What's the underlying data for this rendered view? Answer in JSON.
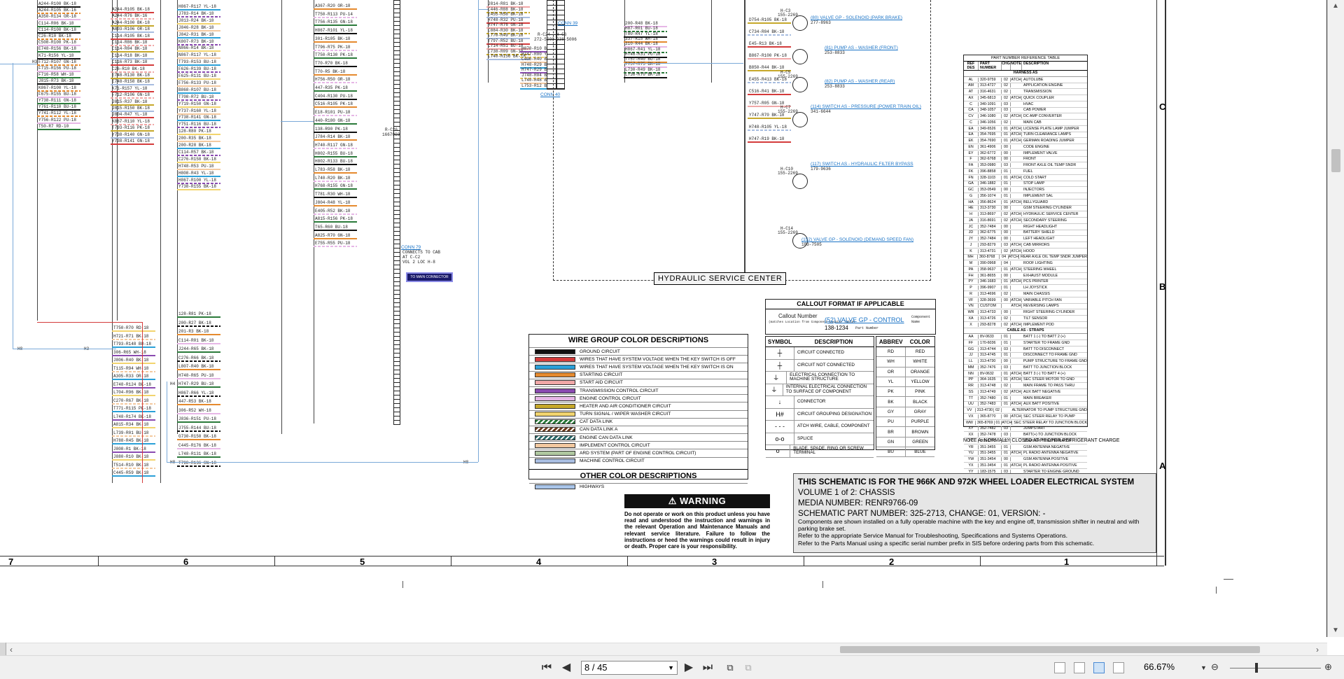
{
  "wire_group_color_descriptions": {
    "title": "WIRE GROUP COLOR DESCRIPTIONS",
    "rows": [
      {
        "color": "#111111",
        "label": "GROUND CIRCUIT"
      },
      {
        "color": "#d43b3b",
        "label": "WIRES THAT HAVE SYSTEM VOLTAGE WHEN THE KEY SWITCH IS OFF"
      },
      {
        "color": "#2aa0d8",
        "label": "WIRES THAT HAVE SYSTEM VOLTAGE WHEN THE KEY SWITCH IS ON"
      },
      {
        "color": "#e58a2e",
        "label": "STARTING CIRCUIT"
      },
      {
        "color": "#f1a8a8",
        "label": "START AID CIRCUIT"
      },
      {
        "color": "#8a4ab0",
        "label": "TRANSMISSION CONTROL CIRCUIT"
      },
      {
        "color": "#e6b7e6",
        "label": "ENGINE CONTROL CIRCUIT"
      },
      {
        "color": "#c6a82a",
        "label": "HEATER AND AIR CONDITIONER CIRCUIT"
      },
      {
        "color": "#f2d46e",
        "label": "TURN SIGNAL / WIPER WASHER CIRCUIT"
      },
      {
        "color": "#2a7a3a",
        "label": "CAT DATA LINK"
      },
      {
        "color": "#6b3a1a",
        "label": "CAN DATA LINK A"
      },
      {
        "color": "#2b6b6b",
        "label": "ENGINE CAN DATA LINK"
      },
      {
        "color": "#f3c9a0",
        "label": "IMPLEMENT CONTROL CIRCUIT"
      },
      {
        "color": "#b0c8a0",
        "label": "ARD SYSTEM (PART OF ENGINE CONTROL CIRCUIT)"
      },
      {
        "color": "#a8bde0",
        "label": "MACHINE CONTROL CIRCUIT"
      }
    ],
    "other_title": "OTHER COLOR DESCRIPTIONS",
    "other_rows": [
      {
        "color": "#a8c4e8",
        "label": "HIGHWAYS"
      }
    ]
  },
  "callout": {
    "title": "CALLOUT FORMAT IF APPLICABLE",
    "callout_number": "Callout Number",
    "callout_sub": "(matches Location from Component Locator Table)",
    "example": "(52) VALVE GP - CONTROL",
    "component_name": "Component Name",
    "part_number": "138-1234",
    "part_number_label": "Part Number"
  },
  "symbols": {
    "col_symbol": "SYMBOL",
    "col_description": "DESCRIPTION",
    "rows": [
      {
        "sym": "┼",
        "desc": "CIRCUIT CONNECTED"
      },
      {
        "sym": "┼",
        "desc": "CIRCUIT NOT CONNECTED"
      },
      {
        "sym": "⏚",
        "desc": "ELECTRICAL CONNECTION TO MACHINE STRUCTURE"
      },
      {
        "sym": "⏚",
        "desc": "INTERNAL ELECTRICAL CONNECTION TO SURFACE OF COMPONENT"
      },
      {
        "sym": "↓",
        "desc": "CONNECTOR"
      },
      {
        "sym": "H#",
        "desc": "CIRCUIT GROUPING DESIGNATION"
      },
      {
        "sym": "- - -",
        "desc": "ATCH WIRE, CABLE, COMPONENT"
      },
      {
        "sym": "o-o",
        "desc": "SPLICE"
      },
      {
        "sym": "o",
        "desc": "BLADE, SPADE, RING OR SCREW TERMINAL"
      }
    ]
  },
  "abbrev": {
    "col_abbrev": "ABBREV",
    "col_color": "COLOR",
    "rows": [
      {
        "a": "RD",
        "c": "RED"
      },
      {
        "a": "WH",
        "c": "WHITE"
      },
      {
        "a": "OR",
        "c": "ORANGE"
      },
      {
        "a": "YL",
        "c": "YELLOW"
      },
      {
        "a": "PK",
        "c": "PINK"
      },
      {
        "a": "BK",
        "c": "BLACK"
      },
      {
        "a": "GY",
        "c": "GRAY"
      },
      {
        "a": "PU",
        "c": "PURPLE"
      },
      {
        "a": "BR",
        "c": "BROWN"
      },
      {
        "a": "GN",
        "c": "GREEN"
      },
      {
        "a": "BU",
        "c": "BLUE"
      }
    ]
  },
  "part_number_reference": {
    "title": "PART NUMBER REFERENCE TABLE",
    "headers": [
      "REF DES",
      "PART NUMBER",
      "CHG",
      "NOTE",
      "DESCRIPTION"
    ],
    "section1": "HARNESS AS",
    "rows1": [
      [
        "AL",
        "320-9759",
        "02",
        "ATCH",
        "AUTOLUBE"
      ],
      [
        "AM",
        "313-4727",
        "02",
        "",
        "APPLICATION ENGINE"
      ],
      [
        "AT",
        "316-4631",
        "02",
        "",
        "TRANSMISSION"
      ],
      [
        "AX",
        "345-6813",
        "02",
        "ATCH",
        "QUICK COUPLER"
      ],
      [
        "C",
        "340-1091",
        "03",
        "",
        "HVAC"
      ],
      [
        "CA",
        "348-1057",
        "03",
        "",
        "CAB POWER"
      ],
      [
        "CV",
        "346-1080",
        "02",
        "ATCH",
        "DC AMP CONVERTER"
      ],
      [
        "C",
        "346-1056",
        "02",
        "",
        "MAIN CAB"
      ],
      [
        "EA",
        "349-6526",
        "01",
        "ATCH",
        "LICENSE PLATE LAMP JUMPER"
      ],
      [
        "EA",
        "354-7695",
        "01",
        "ATCH",
        "TURN CLEARANCE LAMPS"
      ],
      [
        "EK",
        "354-7690",
        "01",
        "ATCH",
        "GERMAN ROADING JUMPER"
      ],
      [
        "EN",
        "361-4906",
        "00",
        "",
        "CODE ENGINE"
      ],
      [
        "EY",
        "362-6772",
        "00",
        "",
        "IMPLEMENT VALVE"
      ],
      [
        "F",
        "362-6768",
        "00",
        "",
        "FRONT"
      ],
      [
        "FA",
        "353-0980",
        "03",
        "",
        "FRONT AXLE OIL TEMP SNDR"
      ],
      [
        "FK",
        "396-8858",
        "01",
        "",
        "FUEL"
      ],
      [
        "FN",
        "328-1103",
        "01",
        "ATCH",
        "COLD START"
      ],
      [
        "GA",
        "346-1882",
        "01",
        "",
        "STOP LAMP"
      ],
      [
        "GC",
        "353-0549",
        "00",
        "",
        "INJECTORS"
      ],
      [
        "G",
        "356-1074",
        "01",
        "",
        "IMPLEMENT SAL"
      ],
      [
        "HA",
        "356-8624",
        "01",
        "ATCH",
        "BELLYGUARD"
      ],
      [
        "HE",
        "313-3730",
        "00",
        "",
        "GSM STEERING CYLINDER"
      ],
      [
        "H",
        "313-8697",
        "02",
        "ATCH",
        "HYDRAULIC SERVICE CENTER"
      ],
      [
        "JA",
        "316-8691",
        "02",
        "ATCH",
        "SECONDARY STEERING"
      ],
      [
        "JC",
        "352-7484",
        "00",
        "",
        "RIGHT HEADLIGHT"
      ],
      [
        "JD",
        "362-6775",
        "00",
        "",
        "BATTERY SHIELD"
      ],
      [
        "JY",
        "352-7484",
        "00",
        "",
        "LEFT HEADLIGHT"
      ],
      [
        "J",
        "293-8279",
        "03",
        "ATCH",
        "CAB MIRRORS"
      ],
      [
        "K",
        "313-4731",
        "02",
        "ATCH",
        "HOOD"
      ],
      [
        "MH",
        "360-8768",
        "04",
        "ATCH",
        "REAR AXLE OIL TEMP SNDR JUMPER"
      ],
      [
        "M",
        "390-0968",
        "04",
        "",
        "ROOF LIGHTING"
      ],
      [
        "PA",
        "358-9637",
        "01",
        "ATCH",
        "STEERING WHEEL"
      ],
      [
        "FH",
        "361-8655",
        "00",
        "",
        "EXHAUST MODULE"
      ],
      [
        "PY",
        "346-1683",
        "01",
        "ATCH",
        "PCS PRINTER"
      ],
      [
        "P",
        "396-9907",
        "01",
        "",
        "LH JOYSTICK"
      ],
      [
        "R",
        "313-4696",
        "02",
        "",
        "MAIN CHASSIS"
      ],
      [
        "VF",
        "328-3699",
        "00",
        "ATCH",
        "VARIABLE PITCH FAN"
      ],
      [
        "VN",
        "CUSTOM",
        "",
        "ATCH",
        "REVERSING LAMPS"
      ],
      [
        "WR",
        "313-4733",
        "00",
        "",
        "RIGHT STEERING CYLINDER"
      ],
      [
        "XA",
        "313-4726",
        "02",
        "",
        "TILT SENSOR"
      ],
      [
        "X",
        "293-8278",
        "02",
        "ATCH",
        "IMPLEMENT POD"
      ]
    ],
    "section2": "CABLE AS - STRAPS",
    "rows2": [
      [
        "AA",
        "8V-0633",
        "01",
        "",
        "BATT 1 (-) TO BATT 2 (+)"
      ],
      [
        "FF",
        "170-6036",
        "01",
        "",
        "STARTER TO FRAME GND"
      ],
      [
        "GG",
        "313-4744",
        "03",
        "",
        "BATT TO DISCONNECT"
      ],
      [
        "JJ",
        "313-4745",
        "01",
        "",
        "DISCONNECT TO FRAME GND"
      ],
      [
        "LL",
        "313-4730",
        "00",
        "",
        "PUMP STRUCTURE TO FRAME GND"
      ],
      [
        "MM",
        "352-7476",
        "03",
        "",
        "BATT TO JUNCTION BLOCK"
      ],
      [
        "NN",
        "8V-0632",
        "01",
        "ATCH",
        "BATT 3 (-) TO BATT 4 (+)"
      ],
      [
        "PP",
        "364-1635",
        "01",
        "ATCH",
        "SEC STEER MOTOR TO GND"
      ],
      [
        "RR",
        "313-4748",
        "02",
        "",
        "MAIN FRAME TO PASS THRU"
      ],
      [
        "SS",
        "313-4749",
        "02",
        "ATCH",
        "AUX BATT NEGATIVE"
      ],
      [
        "TT",
        "352-7480",
        "01",
        "",
        "MAIN BREAKER"
      ],
      [
        "UU",
        "352-7483",
        "01",
        "ATCH",
        "AUX BATT POSITIVE"
      ],
      [
        "VV",
        "313-4730",
        "02",
        "",
        "ALTERNATOR TO PUMP STRUCTURE GND"
      ],
      [
        "VX",
        "365-8770",
        "00",
        "ATCH",
        "SEC STEER RELAY TO PUMP"
      ],
      [
        "WW",
        "365-8769",
        "01",
        "ATCH",
        "SEC STEER RELAY TO JUNCTION BLOCK"
      ],
      [
        "XY",
        "352-7482",
        "03",
        "",
        "JUMPSTART"
      ],
      [
        "XX",
        "352-7478",
        "03",
        "",
        "BATT(+) TO JUNCTION BLOCK"
      ],
      [
        "YC",
        "365-8771",
        "01",
        "",
        "STARTER TO ALTERNATOR"
      ],
      [
        "YR",
        "351-3455",
        "01",
        "",
        "GSM ANTENNA NEGATIVE"
      ],
      [
        "YU",
        "351-3455",
        "01",
        "ATCH",
        "PL RADIO ANTENNA NEGATIVE"
      ],
      [
        "YW",
        "351-3454",
        "00",
        "",
        "GSM ANTENNA POSITIVE"
      ],
      [
        "YX",
        "351-3454",
        "01",
        "ATCH",
        "PL RADIO ANTENNA POSITIVE"
      ],
      [
        "YY",
        "183-1575",
        "03",
        "",
        "STARTER TO ENGINE GROUND"
      ]
    ]
  },
  "note": "NOTE A: NORMALLY CLOSED AT PROPER REFRIGERANT CHARGE",
  "warning": {
    "header": "WARNING",
    "text": "Do not operate or work on this product unless you have read and understood the instruction and warnings in the relevant Operation and Maintenance Manuals and relevant service literature. Failure to follow the instructions or heed the warnings could result in injury or death. Proper care is your responsibility."
  },
  "title_block": {
    "line1": "THIS SCHEMATIC IS FOR THE 966K AND 972K WHEEL LOADER ELECTRICAL SYSTEM",
    "line2": "VOLUME 1 of 2: CHASSIS",
    "line3": "MEDIA NUMBER: RENR9766-09",
    "line4": "SCHEMATIC PART NUMBER: 325-2713, CHANGE: 01, VERSION: -",
    "line5": "Components are shown installed on a fully operable machine with the key and engine off, transmission shifter in neutral and with parking brake set.",
    "line6": "Refer to the appropriate Service Manual for Troubleshooting, Specifications and Systems Operations.",
    "line7": "Refer to the Parts Manual using a specific serial number prefix in SIS before ordering parts from this schematic."
  },
  "hydraulic_service_center": "HYDRAULIC SERVICE CENTER",
  "connectors": {
    "conn39": "CONN 39",
    "conn40": "CONN 40",
    "conn79": "CONN 79",
    "conn79_sub1": "CONNECTS TO CAB",
    "conn79_sub2": "AT C-C2",
    "conn79_sub3": "VOL 2 LOC H-8",
    "to_main": "TO MAIN CONNECTOR",
    "rc24": "R-C24",
    "rc24_pn": "272-5000",
    "hc6": "H-C6",
    "hc6_pn": "238-5006",
    "rc26": "R-C26",
    "rc26_pn": "1667000"
  },
  "components": [
    {
      "callout": "H-C3",
      "pn": "155-2269",
      "label": "(80) VALVE GP - SOLENOID (PARK BRAKE)",
      "pn2": "277-8963"
    },
    {
      "callout": "",
      "pn": "",
      "label": "(81) PUMP AS - WASHER (FRONT)",
      "pn2": "253-8833"
    },
    {
      "callout": "H-C5",
      "pn": "155-2269",
      "label": "(82) PUMP AS - WASHER (REAR)",
      "pn2": "253-8833"
    },
    {
      "callout": "H-C7",
      "pn": "155-2269",
      "label": "(114) SWITCH AS - PRESSURE (POWER TRAIN OIL)",
      "pn2": "341-6644"
    },
    {
      "callout": "H-C10",
      "pn": "155-2269",
      "label": "(117) SWITCH AS - HYDRAULIC FILTER BYPASS",
      "pn2": "179-9636"
    },
    {
      "callout": "H-C14",
      "pn": "155-2269",
      "label": "(152) VALVE GP - SOLENOID (DEMAND SPEED FAN)",
      "pn2": "183-7505"
    }
  ],
  "zones": [
    "C",
    "B",
    "A"
  ],
  "columns": [
    "7",
    "6",
    "5",
    "4",
    "3",
    "2",
    "1"
  ],
  "wire_bus_markers": [
    "H3",
    "H3",
    "H8",
    "H4",
    "H8",
    "H8"
  ],
  "wire_labels": {
    "bus1": [
      "A244-R100 BK-18",
      "A244-R105 BK-16",
      "A350-R134 OR-18",
      "C114-R06 BK-18",
      "C114-R100 BK-18",
      "C26-R10 BK-18",
      "C508-R100 PK-18",
      "E748-R156 BK-18",
      "K71-R156 YL-18",
      "F712-R107 GN-18",
      "F715-R156 PU-18",
      "F716-R58 WH-18",
      "J815-R73 BK-18",
      "K867-R100 YL-18",
      "F675-R155 BU-18",
      "Y738-R111 GN-18",
      "Y761-R110 BU-18",
      "Y741-R112 YL-18",
      "Y756-R122 PU-18",
      "T50-R7 RD-10"
    ],
    "bus2": [
      "A244-R105 BK-18",
      "A244-R76 BK-16",
      "A244-R100 BK-18",
      "A803-R106 OR-18",
      "C114-R105 BK-18",
      "C114-R86 BK-18",
      "C114-R04 BK-18",
      "C114-R18 BK-18",
      "C116-R73 BK-18",
      "C26-R10 BK-18",
      "E748-R130 BK-18",
      "E748-R158 BK-18",
      "K71-R157 YL-18",
      "F712-R106 GN-18",
      "J815-R37 BK-18",
      "J815-R150 BK-18",
      "J804-R47 YL-18",
      "K867-R110 YL-18",
      "T793-R116 PK-18",
      "Y738-R140 GN-18",
      "Y738-R141 GN-18"
    ],
    "bus3": [
      "H867-R117 YL-18",
      "J783-R14 BK-18",
      "J813-R24 BK-18",
      "J846-R28 BK-18",
      "J842-R31 BK-18",
      "K807-R73 BK-18",
      "N866-R14 BK-18",
      "N867-R117 YL-18",
      "T793-R153 BU-18",
      "F626-R139 BU-18",
      "F625-R131 BU-18",
      "F756-R133 PU-18",
      "B868-R107 BU-18",
      "T708-R72 BU-18",
      "Y719-R150 GN-18",
      "Y737-R160 YL-18",
      "Y738-R141 GN-18",
      "Y751-R116 BU-18",
      "128-R80 PK-18",
      "200-R35 BK-18",
      "200-R28 BK-18",
      "C114-R57 BK-18",
      "C276-R158 BK-18",
      "H748-R53 PU-18",
      "H808-R43 YL-18",
      "H867-R100 YL-18",
      "Y738-R155 BK-18"
    ],
    "bus4": [
      "A367-R20 OR-18",
      "T750-R113 PU-14",
      "T756-R135 GN-18",
      "H867-R101 YL-18",
      "301-R105 BK-18",
      "T796-R75 PK-18",
      "T750-R130 PK-18",
      "T70-R70 BK-18",
      "T70-R5 BK-18",
      "H756-R50 OR-18",
      "447-R35 PK-18",
      "C404-R130 PU-18",
      "C516-R105 PK-18",
      "E18-R101 PU-18",
      "440-R180 GN-18",
      "138-R90 PK-18",
      "J784-R14 BK-18",
      "H740-R117 GN-18",
      "H802-R155 BU-18",
      "H802-R133 BU-18",
      "L783-R58 BK-18",
      "L740-R20 BK-18",
      "H768-R155 GN-18",
      "T781-R30 WH-18",
      "J804-R48 YL-18",
      "E405-R52 BK-18",
      "A815-R156 PK-18",
      "T65-R60 BU-18",
      "A825-R70 GN-18",
      "E755-R55 PU-18"
    ],
    "bus5": [
      "J814-R81 BK-18",
      "C446-R88 BK-18",
      "E455-R58 BK-18",
      "H748-R32 PU-18",
      "H747-R76 GN-18",
      "C884-R30 BK-18",
      "L770-R49 BK-18",
      "T797-R52 BU-18",
      "C714-R51 BU-18",
      "C738-R09 GN-18",
      "L740-R156 BK-18"
    ],
    "bus6": [
      "H870-R10 BK-18",
      "H747-R00 YL-18",
      "C406-R40 BK-18",
      "H748-R29 BU-18",
      "H747-R29 BK-18",
      "J748-R04 BU-18",
      "L740-R48 BK-18",
      "L753-R12 BK-18"
    ],
    "bus7": [
      "200-R48 BK-18",
      "H87-R01 BU-18",
      "T80-R47 YL-18",
      "337-R15 WH-18",
      "310-R44 BK-18",
      "H867-R41 YL-18",
      "H748-R31 PU-18",
      "T757-R40 BU-18",
      "T757-R75 BK-18",
      "L730-R49 BK-18",
      "L730-R70 BK-18"
    ],
    "bus8": [
      "D754-R105 BK-18",
      "C734-R04 BK-18",
      "E45-R13 BK-18",
      "B867-R100 PK-18",
      "B850-R44 BK-18",
      "E455-R413 BK-18",
      "C516-R41 BK-18",
      "Y757-R05 GN-18",
      "Y747-R70 BK-18",
      "H748-R105 YL-18",
      "H747-R19 BK-18"
    ],
    "bus9": [
      "T750-R70 RD-18",
      "H721-R71 BK-18",
      "T793-R148 BU-18",
      "306-R65 WH-18",
      "J806-R40 BK-18",
      "T115-R94 WH-18",
      "A305-R33 OR-18",
      "E748-R124 BK-18",
      "L704-R96 BK-18",
      "C270-R67 BK-18",
      "T771-R115 PK-18",
      "L748-R174 BK-18",
      "A815-R34 BK-18",
      "L739-R01 BU-18",
      "H788-R45 BK-18",
      "J808-R1 BK-18",
      "J880-R10 BK-18",
      "T514-R10 BK-18",
      "C445-R59 BK-18"
    ],
    "bus10": [
      "128-R81 PK-18",
      "200-R27 BK-18",
      "201-R3 BK-18",
      "C114-R01 BK-18",
      "J244-R65 BK-18",
      "C276-R66 BK-18",
      "L807-R40 BK-18",
      "H748-R65 PU-18",
      "H747-R29 BU-18",
      "H867-R66 YL-18",
      "447-R53 BK-18",
      "306-R52 WH-18",
      "J836-R151 PU-18",
      "J755-R144 BU-18",
      "G730-R150 BK-18",
      "C445-R176 BK-18",
      "L748-R131 BK-18",
      "T798-R136 GN-18"
    ]
  },
  "statusbar": {
    "page_value": "8 / 45",
    "zoom": "66.67%",
    "zoom_fraction": 0.28
  }
}
